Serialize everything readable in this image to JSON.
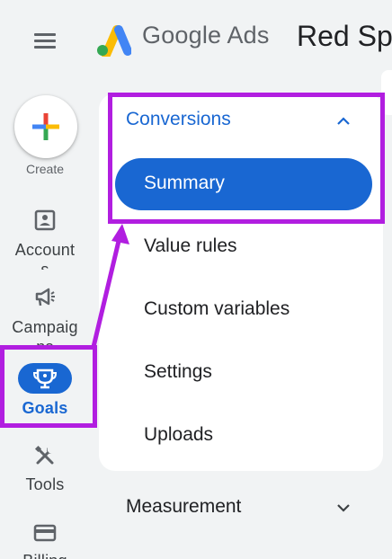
{
  "header": {
    "product_name": "Google Ads",
    "account_name": "Red Sp"
  },
  "rail": {
    "create_label": "Create",
    "items": [
      {
        "label": "Account",
        "overflow": "s",
        "icon": "account-icon"
      },
      {
        "label": "Campaig",
        "overflow": "ns",
        "icon": "megaphone-icon"
      },
      {
        "label": "Goals",
        "icon": "trophy-icon",
        "active": true
      },
      {
        "label": "Tools",
        "icon": "tools-icon"
      },
      {
        "label": "Billing",
        "icon": "credit-card-icon"
      }
    ]
  },
  "submenu": {
    "section_title": "Conversions",
    "items": [
      {
        "label": "Summary",
        "selected": true
      },
      {
        "label": "Value rules"
      },
      {
        "label": "Custom variables"
      },
      {
        "label": "Settings"
      },
      {
        "label": "Uploads"
      }
    ],
    "next_section": "Measurement"
  },
  "colors": {
    "accent": "#1967d2",
    "highlight": "#b11ee0",
    "background": "#f1f3f4"
  }
}
